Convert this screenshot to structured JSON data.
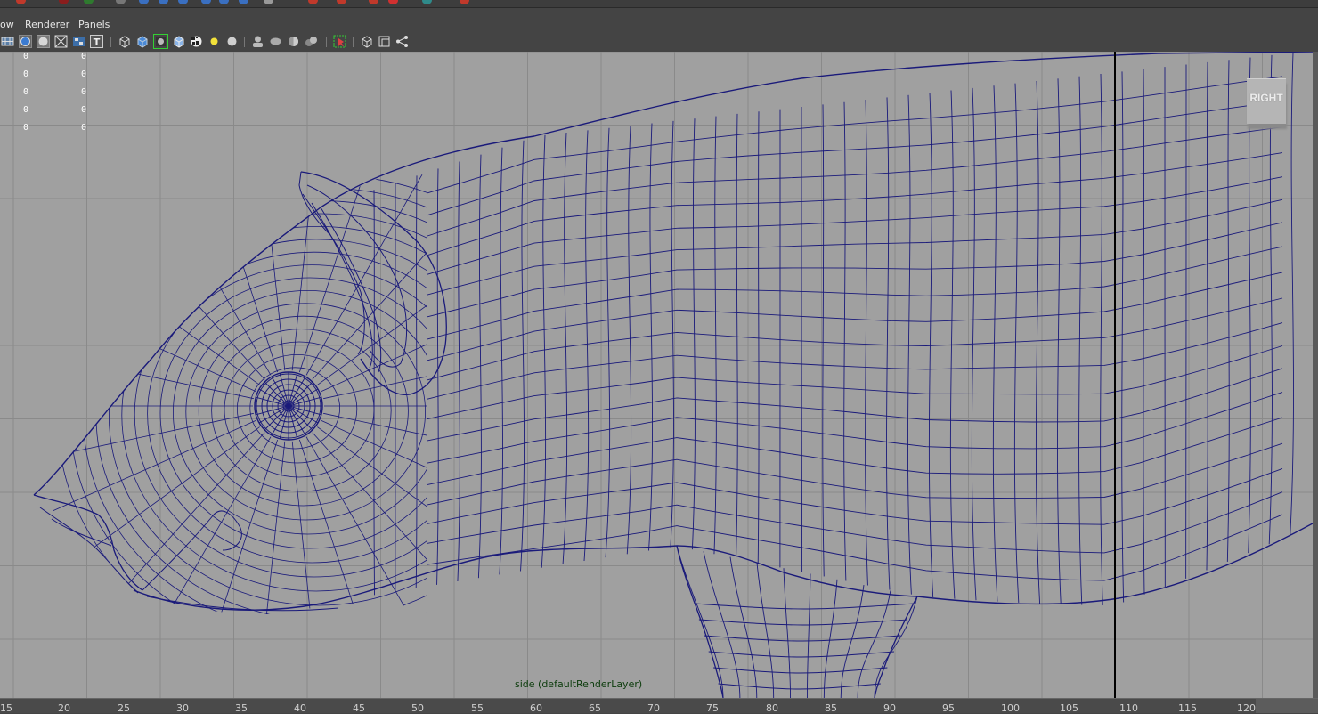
{
  "menubar": {
    "items": [
      "ow",
      "Renderer",
      "Panels"
    ]
  },
  "toolbar": {
    "icons": [
      "grid-icon",
      "sphere-icon",
      "circle-icon",
      "wire-x-icon",
      "checker-icon",
      "text-t-icon",
      "cube-wire-icon",
      "cube-shaded-icon",
      "isolate-select-icon",
      "cube-textured-icon",
      "checker-pattern-icon",
      "light-icon",
      "sphere-gray-icon",
      "head-icon",
      "ellipse-icon",
      "half-sphere-icon",
      "layered-spheres-icon",
      "select-arrow-icon",
      "cube-frame-icon",
      "panels-icon",
      "share-icon"
    ]
  },
  "hud": {
    "values": [
      {
        "a": "0",
        "b": "0"
      },
      {
        "a": "0",
        "b": "0"
      },
      {
        "a": "0",
        "b": "0"
      },
      {
        "a": "0",
        "b": "0"
      },
      {
        "a": "0",
        "b": "0"
      }
    ]
  },
  "viewcube": {
    "label": "RIGHT"
  },
  "camera": {
    "label": "side (defaultRenderLayer)"
  },
  "timeline": {
    "ticks": [
      "15",
      "20",
      "25",
      "30",
      "35",
      "40",
      "45",
      "50",
      "55",
      "60",
      "65",
      "70",
      "75",
      "80",
      "85",
      "90",
      "95",
      "100",
      "105",
      "110",
      "115",
      "120"
    ]
  },
  "colors": {
    "viewport_bg": "#a0a0a0",
    "wireframe": "#1a1a7a",
    "grid": "#8a8a8a"
  }
}
